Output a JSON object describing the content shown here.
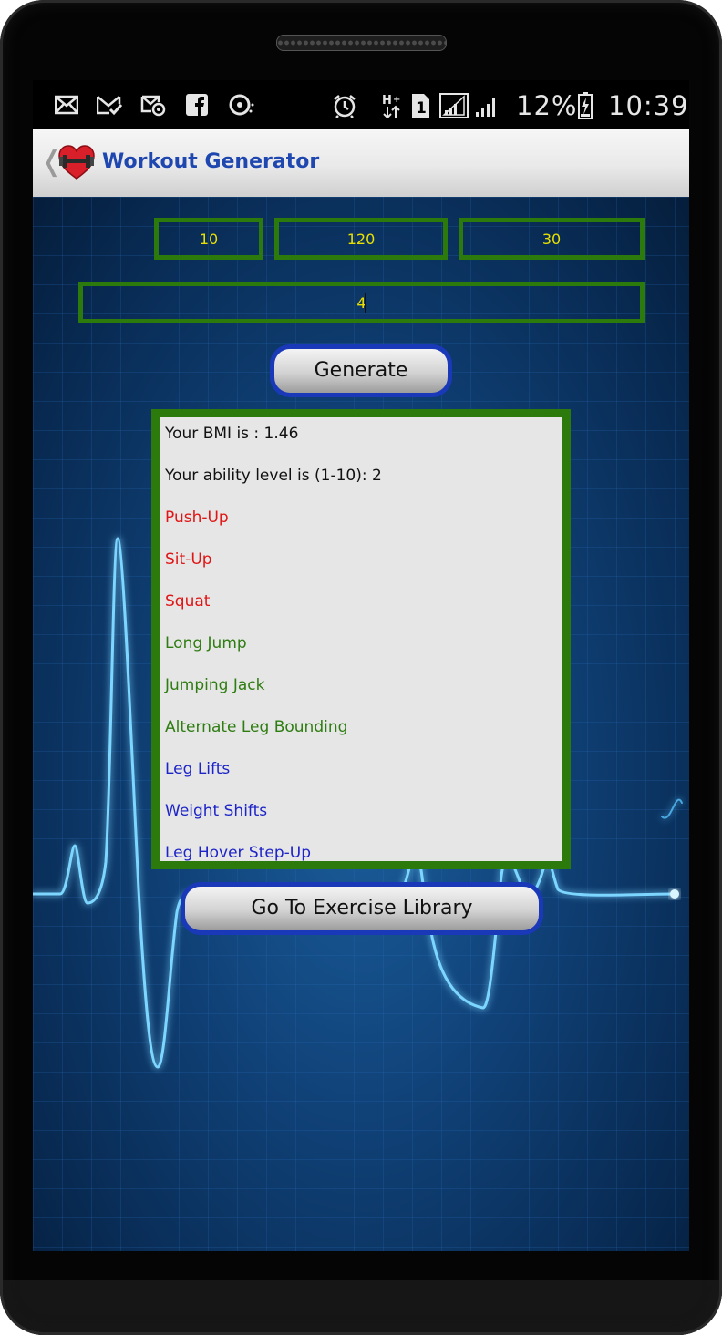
{
  "status_bar": {
    "icons": [
      "email-icon",
      "email-check-icon",
      "email-at-icon",
      "facebook-icon",
      "sync-icon",
      "alarm-icon",
      "hplus-data-icon",
      "sim-1-icon",
      "signal-1-icon",
      "signal-2-icon",
      "battery-icon"
    ],
    "sim_number": "1",
    "battery_text": "12%",
    "time": "10:39"
  },
  "action_bar": {
    "title": "Workout Generator",
    "logo": "heart-dumbbell-logo"
  },
  "inputs": {
    "field_1": "10",
    "field_2": "120",
    "field_3": "30",
    "field_4": "4"
  },
  "buttons": {
    "generate": "Generate",
    "library": "Go To Exercise Library"
  },
  "results": {
    "bmi": "Your BMI is : 1.46",
    "ability": "Your ability level is (1-10): 2",
    "exercises": [
      {
        "name": "Push-Up",
        "color": "#e01515"
      },
      {
        "name": "Sit-Up",
        "color": "#e01515"
      },
      {
        "name": "Squat",
        "color": "#e01515"
      },
      {
        "name": "Long Jump",
        "color": "#2f7d12"
      },
      {
        "name": "Jumping Jack",
        "color": "#2f7d12"
      },
      {
        "name": "Alternate Leg Bounding",
        "color": "#2f7d12"
      },
      {
        "name": "Leg Lifts",
        "color": "#1d24c8"
      },
      {
        "name": "Weight Shifts",
        "color": "#1d24c8"
      },
      {
        "name": "Leg Hover Step-Up",
        "color": "#1d24c8"
      }
    ]
  },
  "colors": {
    "field_border": "#2b7a0b",
    "field_text": "#e9e000",
    "button_border": "#1a39b8",
    "title": "#1f47b0"
  }
}
